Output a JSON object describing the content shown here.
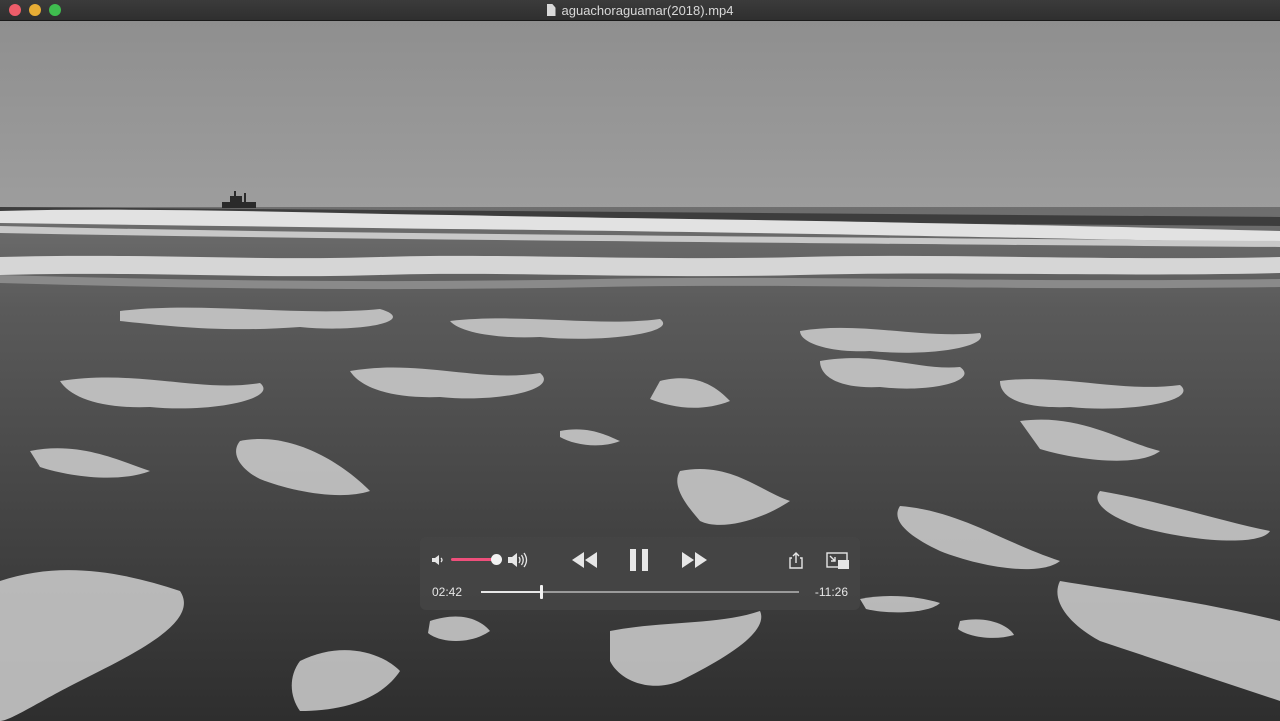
{
  "window": {
    "title": "aguachoraguamar(2018).mp4",
    "title_icon": "document-icon",
    "traffic_lights": {
      "close": "#ee5d6a",
      "minimize": "#e7ad35",
      "maximize": "#3fbd4f"
    }
  },
  "player": {
    "elapsed": "02:42",
    "remaining": "-11:26",
    "progress": 0.19,
    "volume": 0.8,
    "accent_color": "#ee4f7b",
    "controls": {
      "volume_low": "speaker-low-icon",
      "volume_high": "speaker-high-icon",
      "rewind": "rewind-icon",
      "play_pause": "pause-icon",
      "fast_forward": "fast-forward-icon",
      "share": "share-icon",
      "pip": "picture-in-picture-icon"
    }
  }
}
